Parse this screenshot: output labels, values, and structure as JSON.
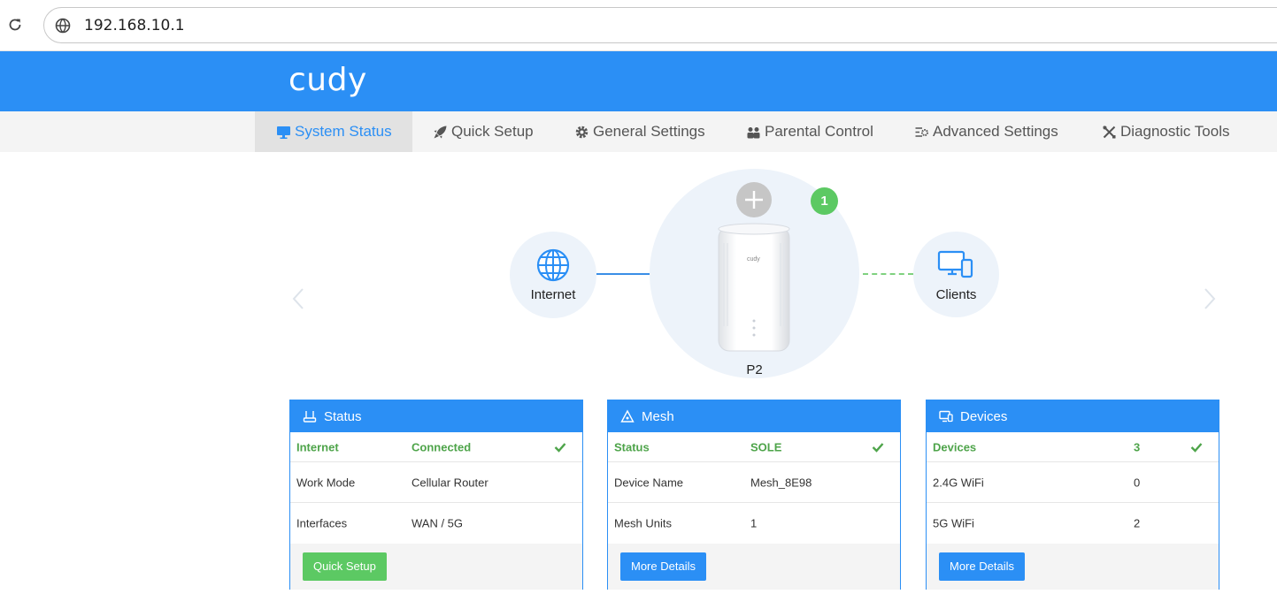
{
  "browser": {
    "url": "192.168.10.1"
  },
  "header": {
    "logo_text": "cudy"
  },
  "nav": {
    "items": [
      {
        "label": "System Status",
        "icon": "monitor-icon",
        "active": true
      },
      {
        "label": "Quick Setup",
        "icon": "rocket-icon",
        "active": false
      },
      {
        "label": "General Settings",
        "icon": "gear-icon",
        "active": false
      },
      {
        "label": "Parental Control",
        "icon": "users-icon",
        "active": false
      },
      {
        "label": "Advanced Settings",
        "icon": "sliders-icon",
        "active": false
      },
      {
        "label": "Diagnostic Tools",
        "icon": "tools-icon",
        "active": false
      }
    ]
  },
  "topology": {
    "internet_label": "Internet",
    "router_label": "P2",
    "router_brand": "cudy",
    "clients_label": "Clients",
    "badge_count": "1"
  },
  "cards": {
    "status": {
      "title": "Status",
      "rows": [
        {
          "label": "Internet",
          "value": "Connected"
        },
        {
          "label": "Work Mode",
          "value": "Cellular Router"
        },
        {
          "label": "Interfaces",
          "value": "WAN / 5G"
        }
      ],
      "button": "Quick Setup"
    },
    "mesh": {
      "title": "Mesh",
      "rows": [
        {
          "label": "Status",
          "value": "SOLE"
        },
        {
          "label": "Device Name",
          "value": "Mesh_8E98"
        },
        {
          "label": "Mesh Units",
          "value": "1"
        }
      ],
      "button": "More Details"
    },
    "devices": {
      "title": "Devices",
      "rows": [
        {
          "label": "Devices",
          "value": "3"
        },
        {
          "label": "2.4G WiFi",
          "value": "0"
        },
        {
          "label": "5G WiFi",
          "value": "2"
        }
      ],
      "button": "More Details"
    }
  },
  "colors": {
    "brand": "#2b8ff5",
    "success": "#5cc963",
    "ok_text": "#4ea44a"
  }
}
